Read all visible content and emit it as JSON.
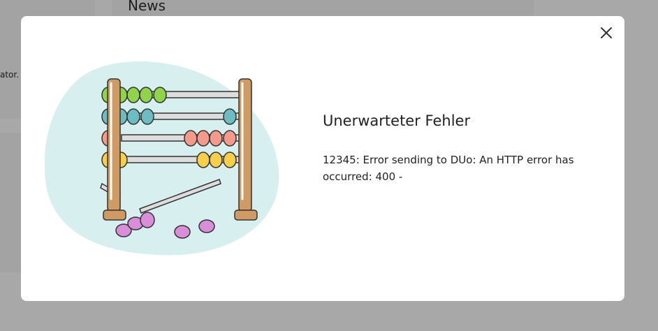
{
  "background": {
    "news_title": "News",
    "left_text": "ator."
  },
  "modal": {
    "title": "Unerwarteter Fehler",
    "message": "12345: Error sending to DUo: An HTTP error has occurred: 400 -",
    "close_icon": "close-icon"
  },
  "colors": {
    "blob": "#d8eff0",
    "wood": "#d09a63",
    "green": "#8fd44a",
    "teal": "#6cbcc4",
    "salmon": "#f39a8a",
    "yellow": "#f7cf4a",
    "purple": "#d98ed9"
  }
}
